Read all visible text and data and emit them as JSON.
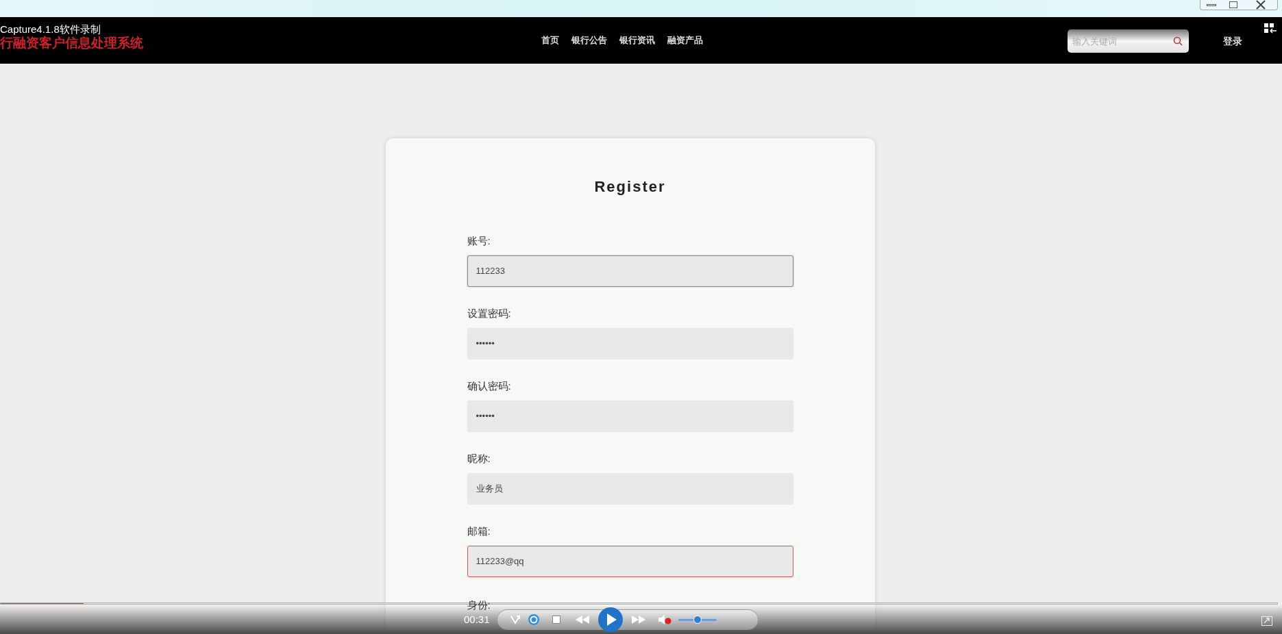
{
  "recorder": {
    "caption": "Capture4.1.8软件录制"
  },
  "header": {
    "title": "行融资客户信息处理系统",
    "nav": [
      {
        "label": "首页"
      },
      {
        "label": "银行公告"
      },
      {
        "label": "银行资讯"
      },
      {
        "label": "融资产品"
      }
    ],
    "search": {
      "placeholder": "输入关键词"
    },
    "login": "登录"
  },
  "form": {
    "title": "Register",
    "fields": [
      {
        "label": "账号:",
        "value": "112233",
        "focused": true,
        "invalid": false
      },
      {
        "label": "设置密码:",
        "value": "••••••",
        "focused": false,
        "invalid": false
      },
      {
        "label": "确认密码:",
        "value": "••••••",
        "focused": false,
        "invalid": false
      },
      {
        "label": "昵称:",
        "value": "业务员",
        "focused": false,
        "invalid": false
      },
      {
        "label": "邮箱:",
        "value": "112233@qq",
        "focused": false,
        "invalid": true
      }
    ],
    "partial_label": "身份:"
  },
  "player": {
    "time": "00:31",
    "progress": {
      "level": 0.065
    },
    "volume": {
      "level": 0.5
    },
    "muted": true
  }
}
